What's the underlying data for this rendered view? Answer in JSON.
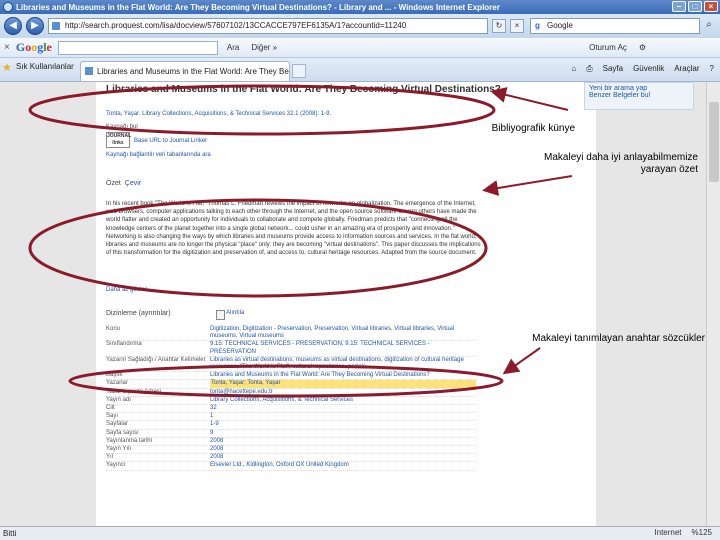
{
  "window": {
    "title": "Libraries and Museums in the Flat World: Are They Becoming Virtual Destinations? - Library and ... - Windows Internet Explorer",
    "buttons": [
      "–",
      "□",
      "×"
    ]
  },
  "address": {
    "url": "http://search.proquest.com/lisa/docview/57607102/13CCACCE797EF6135A/1?accountid=11240",
    "search_placeholder": "Google"
  },
  "google_toolbar": {
    "close": "×",
    "logo_letters": [
      "G",
      "o",
      "o",
      "g",
      "l",
      "e"
    ],
    "search_go": "Ara",
    "more": "Diğer »",
    "signin": "Oturum Aç"
  },
  "tabs": {
    "favorites": "Sık Kullanılanlar",
    "active_tab": "Libraries and Museums in the Flat World: Are They Be...",
    "commands": [
      "Sayfa",
      "Güvenlik",
      "Araçlar"
    ]
  },
  "page": {
    "right_links": [
      "Yeni bir arama yap",
      "Benzer Belgeler bul"
    ],
    "title": "Libraries and Museums in the Flat World: Are They Becoming Virtual Destinations?",
    "authors": "Tonta, Yaşar.   Library Collections, Acquisitions, & Technical Services 32.1  (2008): 1-9.",
    "kaynak": "Kaynağı bul",
    "journal_logo": "JOURNAL links",
    "link_url": "Base URL to Journal Linker",
    "link_findtext": "Kaynağı bağlantılı veri tabanlarında ara",
    "ozet_label": "Özet",
    "ozet_cevir": "Çevir",
    "abstract": "In his recent book \"The World is Flat,\" Thomas L. Friedman reviews the impact of networks on globalization. The emergence of the Internet, web browsers, computer applications talking to each other through the Internet, and the open source software among others have made the world flatter and created an opportunity for individuals to collaborate and compete globally. Friedman predicts that \"connecting all the knowledge centers of the planet together into a single global network... could usher in an amazing era of prosperity and innovation.\" Networking is also changing the ways by which libraries and museums provide access to information sources and services. In the flat world, libraries and museums are no longer the physical \"place\" only: they are becoming \"virtual destinations\". This paper discusses the implications of this transformation for the digitization and preservation of, and access to, cultural heritage resources. Adapted from the source document.",
    "abstract_more": "Daha az göster",
    "section_title": "Dizinleme (ayrıntılar)",
    "cite": "Alıntıla",
    "rows": [
      {
        "k": "Konu",
        "v": "Digitization, Digitization - Preservation, Preservation, Virtual libraries, Virtual libraries, Virtual museums, Virtual museums"
      },
      {
        "k": "Sınıflandırma",
        "v": "9.15: TECHNICAL SERVICES - PRESERVATION, 9.15: TECHNICAL SERVICES - PRESERVATION"
      },
      {
        "k": "Yazarın Sağladığı / Anahtar Kelimeler",
        "v": "Libraries as virtual destinations, museums as virtual destinations, digitization of cultural heritage resources, \"The World is Flat\", cultural repositories, portals"
      },
      {
        "k": "Başlık",
        "v": "Libraries and Museums in the Flat World: Are They Becoming Virtual Destinations?"
      },
      {
        "k": "Yazarlar",
        "v": "Tonta, Yaşar; Tonta, Yaşar"
      },
      {
        "k": "Yazar e-posta Adresi",
        "v": "tonta@hacettepe.edu.tr"
      },
      {
        "k": "Yayın adı",
        "v": "Library Collections, Acquisitions, & Technical Services"
      },
      {
        "k": "Cilt",
        "v": "32"
      },
      {
        "k": "Sayı",
        "v": "1"
      },
      {
        "k": "Sayfalar",
        "v": "1-9"
      },
      {
        "k": "Sayfa sayısı",
        "v": "9"
      },
      {
        "k": "Yayınlanma tarihi",
        "v": "2008"
      },
      {
        "k": "Yayın Yılı",
        "v": "2008"
      },
      {
        "k": "Yıl",
        "v": "2008"
      },
      {
        "k": "Yayıncı",
        "v": "Elsevier Ltd., Kidlington, Oxford OX United Kingdom"
      }
    ]
  },
  "annotations": {
    "kunye": "Bibliyografik künye",
    "ozet": "Makaleyi daha iyi anlayabilmemize yarayan özet",
    "anahtar": "Makaleyi tanımlayan anahtar sözcükler",
    "color": "#8b1a2a"
  },
  "status": {
    "left": "Bitti",
    "right_items": [
      "Internet",
      "%125"
    ]
  }
}
